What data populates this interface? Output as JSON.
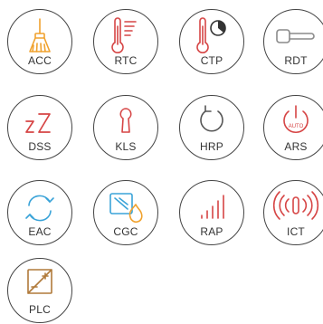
{
  "icons": {
    "acc": {
      "label": "ACC",
      "icon": "broom-icon",
      "color": "#f0a22e"
    },
    "rtc": {
      "label": "RTC",
      "icon": "thermometer-icon",
      "color": "#d64545"
    },
    "ctp": {
      "label": "CTP",
      "icon": "thermometer-timer-icon",
      "color": "#d64545"
    },
    "rdt": {
      "label": "RDT",
      "icon": "door-handle-icon",
      "color": "#8a8a8a"
    },
    "dss": {
      "label": "DSS",
      "icon": "sleep-zz-icon",
      "color": "#d64545"
    },
    "kls": {
      "label": "KLS",
      "icon": "keyhole-icon",
      "color": "#d64545"
    },
    "hrp": {
      "label": "HRP",
      "icon": "refresh-arrow-icon",
      "color": "#555555"
    },
    "ars": {
      "label": "ARS",
      "icon": "power-auto-icon",
      "color": "#d64545",
      "badge": "AUTO"
    },
    "eac": {
      "label": "EAC",
      "icon": "sync-arrows-icon",
      "color": "#3aa3d8"
    },
    "cgc": {
      "label": "CGC",
      "icon": "glass-flame-icon",
      "color": "#3aa3d8",
      "accent": "#f0a22e"
    },
    "rap": {
      "label": "RAP",
      "icon": "signal-bars-icon",
      "color": "#d64545"
    },
    "ict": {
      "label": "ICT",
      "icon": "broadcast-icon",
      "color": "#d64545"
    },
    "plc": {
      "label": "PLC",
      "icon": "plus-minus-panel-icon",
      "color": "#b07a3a"
    }
  }
}
